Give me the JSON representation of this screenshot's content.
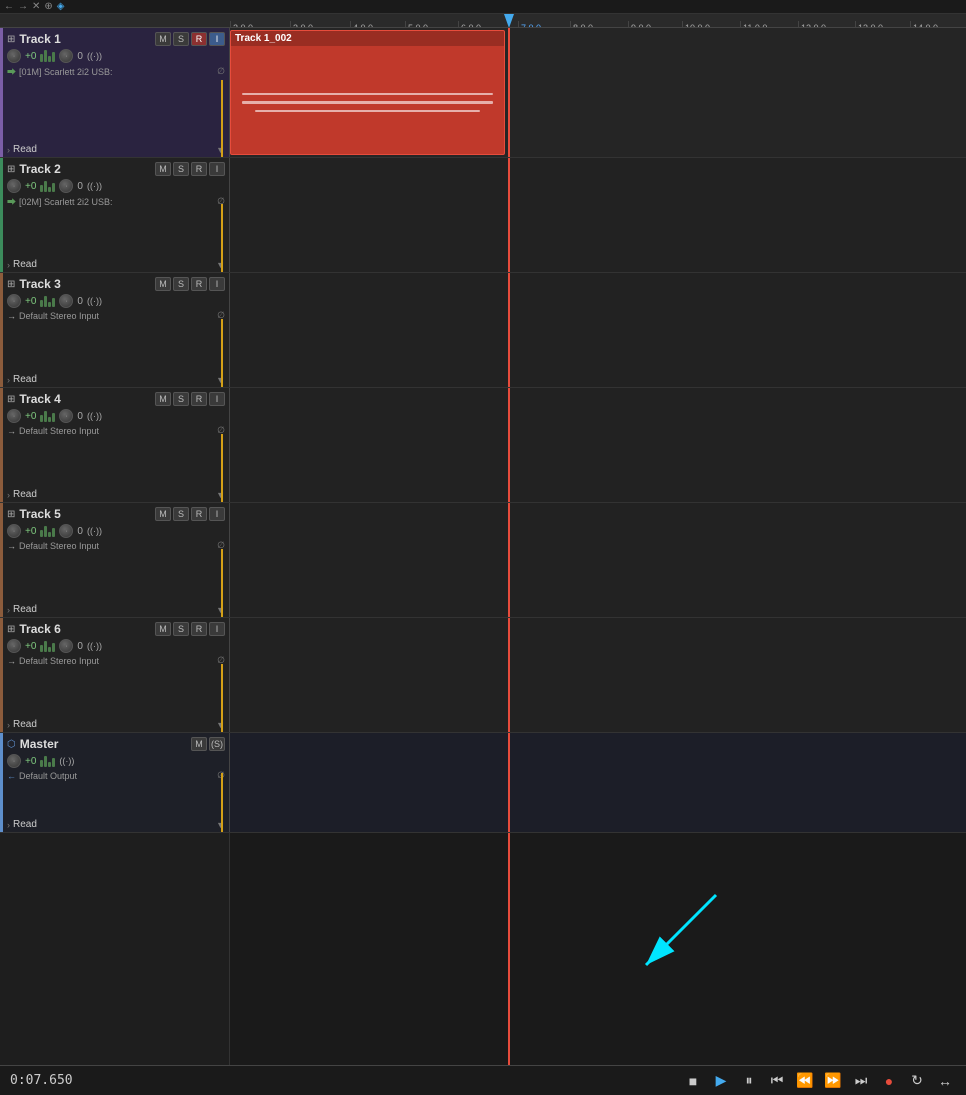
{
  "toolbar": {
    "icons": [
      "←",
      "→",
      "✕",
      "⬢",
      "◀",
      "▶",
      "●",
      "□",
      "⚙"
    ]
  },
  "ruler": {
    "marks": [
      "2.0.0",
      "3.0.0",
      "4.0.0",
      "5.0.0",
      "6.0.0",
      "7.0.0",
      "8.0.0",
      "9.0.0",
      "10.0.0",
      "11.0.0",
      "12.0.0",
      "13.0.0",
      "14.0.0"
    ]
  },
  "tracks": [
    {
      "id": "track1",
      "name": "Track 1",
      "buttons": {
        "m": "M",
        "s": "S",
        "r": "R",
        "i": "I"
      },
      "vol": "+0",
      "pan": "0",
      "input": "[01M] Scarlett 2i2 USB:",
      "read_label": "Read",
      "has_clip": true,
      "clip_name": "Track 1_002"
    },
    {
      "id": "track2",
      "name": "Track 2",
      "buttons": {
        "m": "M",
        "s": "S",
        "r": "R",
        "i": "I"
      },
      "vol": "+0",
      "pan": "0",
      "input": "[02M] Scarlett 2i2 USB:",
      "read_label": "Read",
      "has_clip": false
    },
    {
      "id": "track3",
      "name": "Track 3",
      "buttons": {
        "m": "M",
        "s": "S",
        "r": "R",
        "i": "I"
      },
      "vol": "+0",
      "pan": "0",
      "input": "Default Stereo Input",
      "read_label": "Read",
      "has_clip": false
    },
    {
      "id": "track4",
      "name": "Track 4",
      "buttons": {
        "m": "M",
        "s": "S",
        "r": "R",
        "i": "I"
      },
      "vol": "+0",
      "pan": "0",
      "input": "Default Stereo Input",
      "read_label": "Read",
      "has_clip": false
    },
    {
      "id": "track5",
      "name": "Track 5",
      "buttons": {
        "m": "M",
        "s": "S",
        "r": "R",
        "i": "I"
      },
      "vol": "+0",
      "pan": "0",
      "input": "Default Stereo Input",
      "read_label": "Read",
      "has_clip": false
    },
    {
      "id": "track6",
      "name": "Track 6",
      "buttons": {
        "m": "M",
        "s": "S",
        "r": "R",
        "i": "I"
      },
      "vol": "+0",
      "pan": "0",
      "input": "Default Stereo Input",
      "read_label": "Read",
      "has_clip": false
    },
    {
      "id": "master",
      "name": "Master",
      "is_master": true,
      "buttons": {
        "m": "M",
        "s": "(S)"
      },
      "vol": "+0",
      "input": "Default Output",
      "read_label": "Read",
      "has_clip": false
    }
  ],
  "transport": {
    "time": "0:07.650",
    "stop_label": "■",
    "play_label": "▶",
    "pause_label": "⏸",
    "rewind_start_label": "⏮",
    "rewind_label": "⏪",
    "ff_label": "⏩",
    "ff_end_label": "⏭",
    "record_label": "●",
    "loop_label": "↻",
    "extra_label": "↔"
  }
}
